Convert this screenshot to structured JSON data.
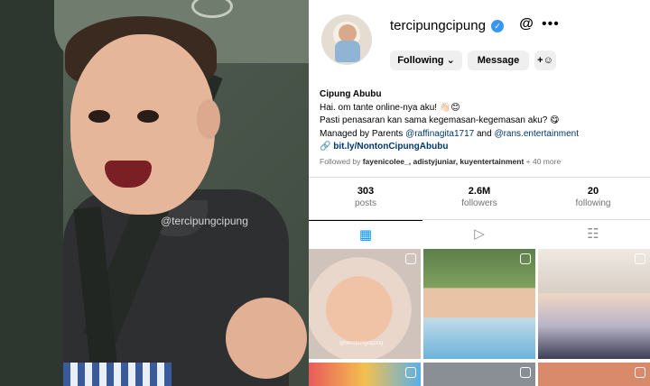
{
  "photo": {
    "watermark": "@tercipungcipung"
  },
  "profile": {
    "username": "tercipungcipung",
    "verified_icon": "verified-badge-icon",
    "actions": {
      "following_label": "Following ⌄",
      "message_label": "Message",
      "add_user_icon": "add-person-icon"
    },
    "bio": {
      "display_name": "Cipung Abubu",
      "line1": "Hai. om tante online-nya aku! 👋🏻😊",
      "line2": "Pasti penasaran kan sama kegemasan-kegemasan aku? 😋",
      "line3_prefix": "Managed by Parents ",
      "mention1": "@raffinagita1717",
      "line3_mid": " and ",
      "mention2": "@rans.entertainment",
      "link": "bit.ly/NontonCipungAbubu",
      "link_icon": "link-icon"
    },
    "followed_by": {
      "prefix": "Followed by ",
      "names": "fayenicolee_, adistyjuniar, kuyentertainment",
      "suffix": " + 40 more"
    },
    "stats": [
      {
        "value": "303",
        "label": "posts"
      },
      {
        "value": "2.6M",
        "label": "followers"
      },
      {
        "value": "20",
        "label": "following"
      }
    ],
    "tabs": [
      {
        "icon": "grid-icon",
        "glyph": "▦",
        "active": true
      },
      {
        "icon": "reels-icon",
        "glyph": "▷",
        "active": false
      },
      {
        "icon": "tagged-icon",
        "glyph": "☷",
        "active": false
      }
    ],
    "post_caption": "@tercipungcipung"
  }
}
